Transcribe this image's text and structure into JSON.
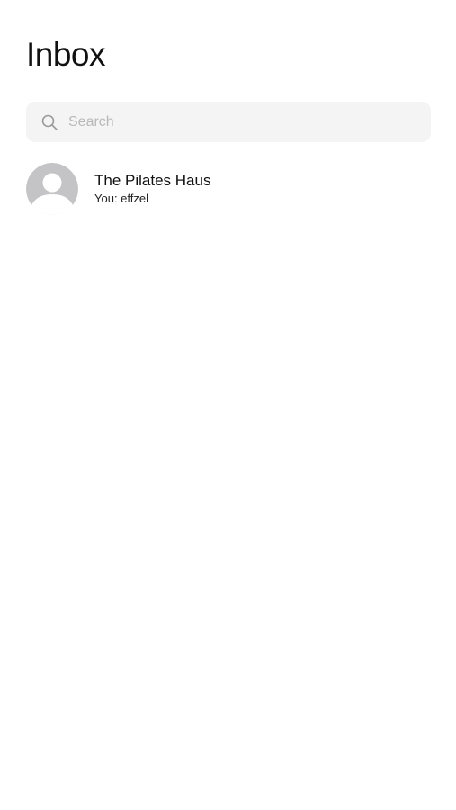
{
  "header": {
    "title": "Inbox"
  },
  "search": {
    "placeholder": "Search",
    "value": "",
    "icon": "search-icon"
  },
  "conversations": [
    {
      "name": "The Pilates Haus",
      "preview": "You: effzel",
      "avatar_icon": "default-avatar-icon"
    }
  ],
  "colors": {
    "background": "#ffffff",
    "search_background": "#f4f4f4",
    "placeholder": "#b9b9b9",
    "avatar_background": "#c4c4c6",
    "text_primary": "#111111"
  }
}
